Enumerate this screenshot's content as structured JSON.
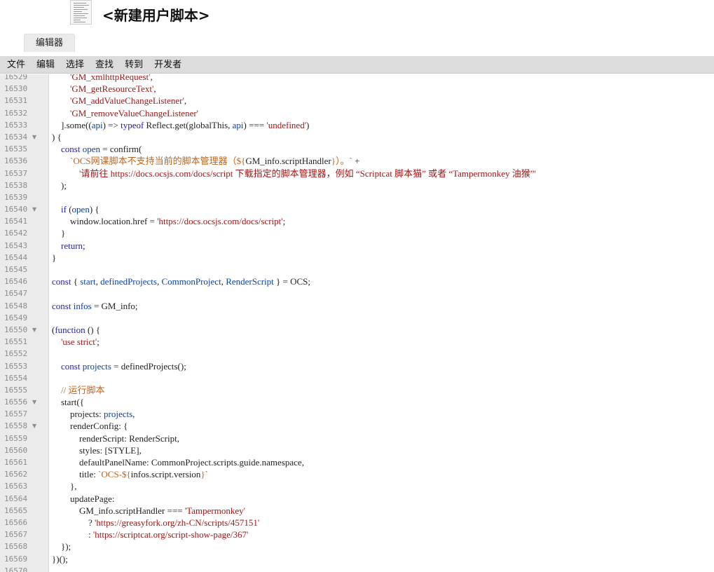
{
  "window": {
    "title": "<新建用户脚本>"
  },
  "tabs": [
    {
      "label": "编辑器"
    }
  ],
  "menu": [
    {
      "label": "文件"
    },
    {
      "label": "编辑"
    },
    {
      "label": "选择"
    },
    {
      "label": "查找"
    },
    {
      "label": "转到"
    },
    {
      "label": "开发者"
    }
  ],
  "editor": {
    "lines": [
      {
        "n": "16529",
        "fold": false,
        "segs": [
          [
            "pr",
            "        "
          ],
          [
            "str",
            "'GM_xmlhttpRequest'"
          ],
          [
            "pr",
            ","
          ]
        ]
      },
      {
        "n": "16530",
        "fold": false,
        "segs": [
          [
            "pr",
            "        "
          ],
          [
            "str",
            "'GM_getResourceText'"
          ],
          [
            "pr",
            ","
          ]
        ]
      },
      {
        "n": "16531",
        "fold": false,
        "segs": [
          [
            "pr",
            "        "
          ],
          [
            "str",
            "'GM_addValueChangeListener'"
          ],
          [
            "pr",
            ","
          ]
        ]
      },
      {
        "n": "16532",
        "fold": false,
        "segs": [
          [
            "pr",
            "        "
          ],
          [
            "str",
            "'GM_removeValueChangeListener'"
          ]
        ]
      },
      {
        "n": "16533",
        "fold": false,
        "segs": [
          [
            "pr",
            "    ].some(("
          ],
          [
            "var",
            "api"
          ],
          [
            "pr",
            ") => "
          ],
          [
            "kw",
            "typeof"
          ],
          [
            "pr",
            " Reflect.get(globalThis, "
          ],
          [
            "var",
            "api"
          ],
          [
            "pr",
            ") === "
          ],
          [
            "str",
            "'undefined'"
          ],
          [
            "pr",
            ")"
          ]
        ]
      },
      {
        "n": "16534",
        "fold": true,
        "segs": [
          [
            "pr",
            ") {"
          ]
        ]
      },
      {
        "n": "16535",
        "fold": false,
        "segs": [
          [
            "pr",
            "    "
          ],
          [
            "kw",
            "const"
          ],
          [
            "pr",
            " "
          ],
          [
            "var",
            "open"
          ],
          [
            "pr",
            " = confirm("
          ]
        ]
      },
      {
        "n": "16536",
        "fold": false,
        "segs": [
          [
            "pr",
            "        "
          ],
          [
            "cm",
            "`OCS网课脚本不支持当前的脚本管理器（${"
          ],
          [
            "pr",
            "GM_info.scriptHandler"
          ],
          [
            "cm",
            "}）。`"
          ],
          [
            "pr",
            " +"
          ]
        ]
      },
      {
        "n": "16537",
        "fold": false,
        "segs": [
          [
            "pr",
            "            "
          ],
          [
            "str",
            "'请前往 https://docs.ocsjs.com/docs/script 下载指定的脚本管理器，例如 “Scriptcat 脚本猫” 或者 “Tampermonkey 油猴”'"
          ]
        ]
      },
      {
        "n": "16538",
        "fold": false,
        "segs": [
          [
            "pr",
            "    );"
          ]
        ]
      },
      {
        "n": "16539",
        "fold": false,
        "segs": [
          [
            "pr",
            ""
          ]
        ]
      },
      {
        "n": "16540",
        "fold": true,
        "segs": [
          [
            "pr",
            "    "
          ],
          [
            "kw",
            "if"
          ],
          [
            "pr",
            " ("
          ],
          [
            "var",
            "open"
          ],
          [
            "pr",
            ") {"
          ]
        ]
      },
      {
        "n": "16541",
        "fold": false,
        "segs": [
          [
            "pr",
            "        window.location.href = "
          ],
          [
            "str",
            "'https://docs.ocsjs.com/docs/script'"
          ],
          [
            "pr",
            ";"
          ]
        ]
      },
      {
        "n": "16542",
        "fold": false,
        "segs": [
          [
            "pr",
            "    }"
          ]
        ]
      },
      {
        "n": "16543",
        "fold": false,
        "segs": [
          [
            "pr",
            "    "
          ],
          [
            "kw",
            "return"
          ],
          [
            "pr",
            ";"
          ]
        ]
      },
      {
        "n": "16544",
        "fold": false,
        "segs": [
          [
            "pr",
            "}"
          ]
        ]
      },
      {
        "n": "16545",
        "fold": false,
        "segs": [
          [
            "pr",
            ""
          ]
        ]
      },
      {
        "n": "16546",
        "fold": false,
        "segs": [
          [
            "kw",
            "const"
          ],
          [
            "pr",
            " { "
          ],
          [
            "var",
            "start"
          ],
          [
            "pr",
            ", "
          ],
          [
            "var",
            "definedProjects"
          ],
          [
            "pr",
            ", "
          ],
          [
            "var",
            "CommonProject"
          ],
          [
            "pr",
            ", "
          ],
          [
            "var",
            "RenderScript"
          ],
          [
            "pr",
            " } = OCS;"
          ]
        ]
      },
      {
        "n": "16547",
        "fold": false,
        "segs": [
          [
            "pr",
            ""
          ]
        ]
      },
      {
        "n": "16548",
        "fold": false,
        "segs": [
          [
            "kw",
            "const"
          ],
          [
            "pr",
            " "
          ],
          [
            "var",
            "infos"
          ],
          [
            "pr",
            " = GM_info;"
          ]
        ]
      },
      {
        "n": "16549",
        "fold": false,
        "segs": [
          [
            "pr",
            ""
          ]
        ]
      },
      {
        "n": "16550",
        "fold": true,
        "segs": [
          [
            "pr",
            "("
          ],
          [
            "kw",
            "function"
          ],
          [
            "pr",
            " () {"
          ]
        ]
      },
      {
        "n": "16551",
        "fold": false,
        "segs": [
          [
            "pr",
            "    "
          ],
          [
            "str",
            "'use strict'"
          ],
          [
            "pr",
            ";"
          ]
        ]
      },
      {
        "n": "16552",
        "fold": false,
        "segs": [
          [
            "pr",
            ""
          ]
        ]
      },
      {
        "n": "16553",
        "fold": false,
        "segs": [
          [
            "pr",
            "    "
          ],
          [
            "kw",
            "const"
          ],
          [
            "pr",
            " "
          ],
          [
            "var",
            "projects"
          ],
          [
            "pr",
            " = definedProjects();"
          ]
        ]
      },
      {
        "n": "16554",
        "fold": false,
        "segs": [
          [
            "pr",
            ""
          ]
        ]
      },
      {
        "n": "16555",
        "fold": false,
        "segs": [
          [
            "pr",
            "    "
          ],
          [
            "cm",
            "// 运行脚本"
          ]
        ]
      },
      {
        "n": "16556",
        "fold": true,
        "segs": [
          [
            "pr",
            "    start({"
          ]
        ]
      },
      {
        "n": "16557",
        "fold": false,
        "segs": [
          [
            "pr",
            "        projects: "
          ],
          [
            "var",
            "projects"
          ],
          [
            "pr",
            ","
          ]
        ]
      },
      {
        "n": "16558",
        "fold": true,
        "segs": [
          [
            "pr",
            "        renderConfig: {"
          ]
        ]
      },
      {
        "n": "16559",
        "fold": false,
        "segs": [
          [
            "pr",
            "            renderScript: RenderScript,"
          ]
        ]
      },
      {
        "n": "16560",
        "fold": false,
        "segs": [
          [
            "pr",
            "            styles: [STYLE],"
          ]
        ]
      },
      {
        "n": "16561",
        "fold": false,
        "segs": [
          [
            "pr",
            "            defaultPanelName: CommonProject.scripts.guide.namespace,"
          ]
        ]
      },
      {
        "n": "16562",
        "fold": false,
        "segs": [
          [
            "pr",
            "            title: "
          ],
          [
            "cm",
            "`OCS-${"
          ],
          [
            "pr",
            "infos.script.version"
          ],
          [
            "cm",
            "}`"
          ]
        ]
      },
      {
        "n": "16563",
        "fold": false,
        "segs": [
          [
            "pr",
            "        },"
          ]
        ]
      },
      {
        "n": "16564",
        "fold": false,
        "segs": [
          [
            "pr",
            "        updatePage:"
          ]
        ]
      },
      {
        "n": "16565",
        "fold": false,
        "segs": [
          [
            "pr",
            "            GM_info.scriptHandler === "
          ],
          [
            "str",
            "'Tampermonkey'"
          ]
        ]
      },
      {
        "n": "16566",
        "fold": false,
        "segs": [
          [
            "pr",
            "                ? "
          ],
          [
            "str",
            "'https://greasyfork.org/zh-CN/scripts/457151'"
          ]
        ]
      },
      {
        "n": "16567",
        "fold": false,
        "segs": [
          [
            "pr",
            "                : "
          ],
          [
            "str",
            "'https://scriptcat.org/script-show-page/367'"
          ]
        ]
      },
      {
        "n": "16568",
        "fold": false,
        "segs": [
          [
            "pr",
            "    });"
          ]
        ]
      },
      {
        "n": "16569",
        "fold": false,
        "segs": [
          [
            "pr",
            "})();"
          ]
        ]
      },
      {
        "n": "16570",
        "fold": false,
        "segs": [
          [
            "pr",
            ""
          ]
        ]
      }
    ]
  }
}
